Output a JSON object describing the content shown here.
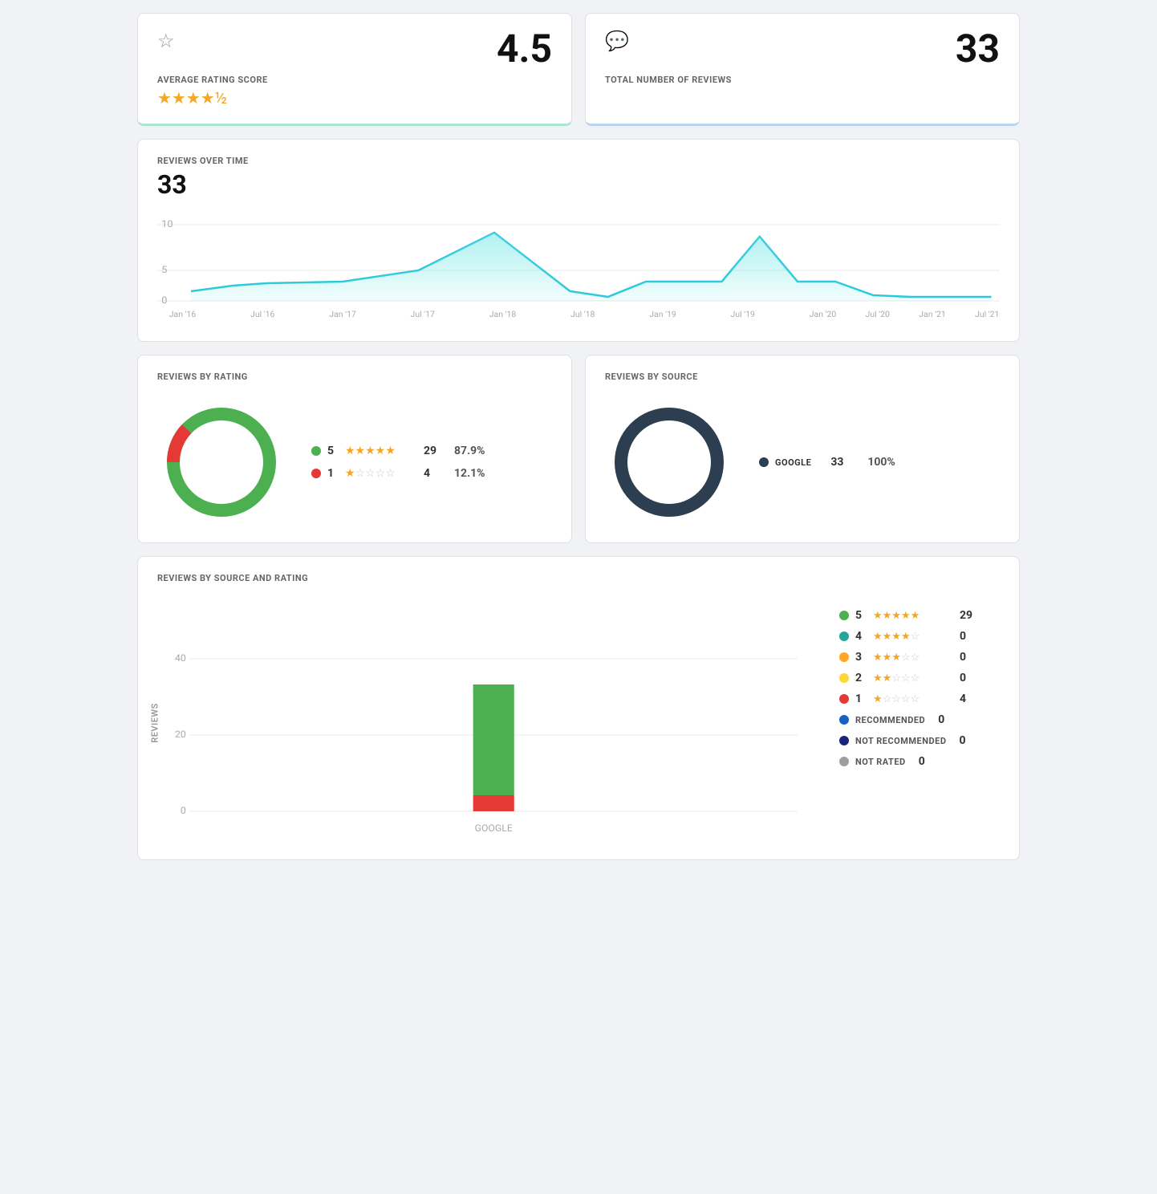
{
  "topStats": {
    "rating": {
      "icon": "★",
      "value": "4.5",
      "label": "AVERAGE RATING SCORE",
      "stars": "★★★★½"
    },
    "reviews": {
      "icon": "💬",
      "value": "33",
      "label": "TOTAL NUMBER OF REVIEWS"
    }
  },
  "overTime": {
    "title": "REVIEWS OVER TIME",
    "count": "33",
    "xLabels": [
      "Jan '16",
      "Jul '16",
      "Jan '17",
      "Jul '17",
      "Jan '18",
      "Jul '18",
      "Jan '19",
      "Jul '19",
      "Jan '20",
      "Jul '20",
      "Jan '21",
      "Jul '21"
    ],
    "yLabels": [
      "10",
      "5",
      "0"
    ]
  },
  "byRating": {
    "title": "REVIEWS BY RATING",
    "items": [
      {
        "color": "#4caf50",
        "starNum": "5",
        "stars": "★★★★★",
        "count": "29",
        "pct": "87.9%"
      },
      {
        "color": "#e53935",
        "starNum": "1",
        "stars": "★☆☆☆☆",
        "count": "4",
        "pct": "12.1%"
      }
    ]
  },
  "bySource": {
    "title": "REVIEWS BY SOURCE",
    "items": [
      {
        "color": "#2c3e50",
        "label": "GOOGLE",
        "count": "33",
        "pct": "100%"
      }
    ]
  },
  "bySourceRating": {
    "title": "REVIEWS BY SOURCE AND RATING",
    "yLabels": [
      "40",
      "20",
      "0"
    ],
    "xLabel": "GOOGLE",
    "legend": [
      {
        "color": "#4caf50",
        "starNum": "5",
        "stars": "★★★★★",
        "count": "29"
      },
      {
        "color": "#26a69a",
        "starNum": "4",
        "stars": "★★★★☆",
        "count": "0"
      },
      {
        "color": "#ffa726",
        "starNum": "3",
        "stars": "★★★☆☆",
        "count": "0"
      },
      {
        "color": "#fdd835",
        "starNum": "2",
        "stars": "★★☆☆☆",
        "count": "0"
      },
      {
        "color": "#e53935",
        "starNum": "1",
        "stars": "★☆☆☆☆",
        "count": "4"
      },
      {
        "color": "#1565c0",
        "label": "RECOMMENDED",
        "count": "0"
      },
      {
        "color": "#1a237e",
        "label": "NOT RECOMMENDED",
        "count": "0"
      },
      {
        "color": "#9e9e9e",
        "label": "NOT RATED",
        "count": "0"
      }
    ]
  }
}
